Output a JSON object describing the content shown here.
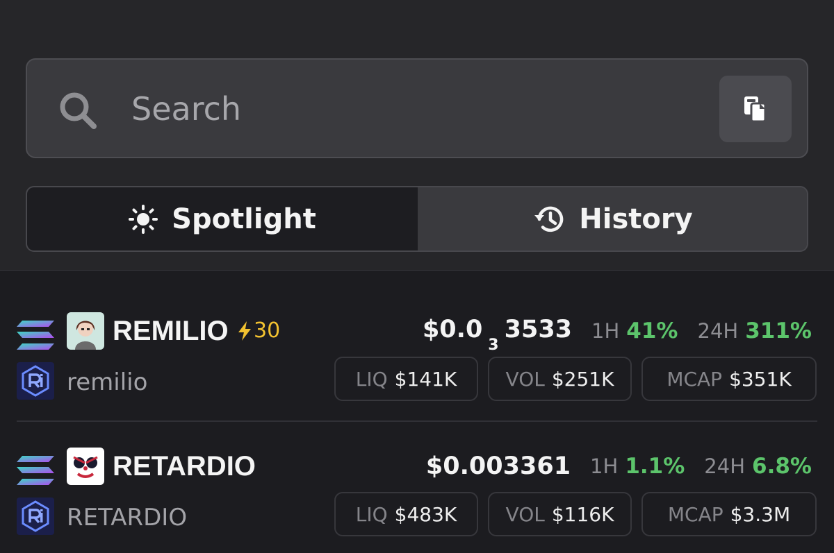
{
  "search": {
    "placeholder": "Search"
  },
  "tabs": [
    {
      "label": "Spotlight",
      "icon": "sun-icon",
      "active": true
    },
    {
      "label": "History",
      "icon": "history-icon",
      "active": false
    }
  ],
  "tokens": [
    {
      "chain_icon": "solana-icon",
      "dex_icon": "raydium-icon",
      "symbol": "REMILIO",
      "boost": "30",
      "name": "remilio",
      "price_prefix": "$0.0",
      "price_zeros": "3",
      "price_digits": "3533",
      "h1_label": "1H",
      "h1_change": "41%",
      "h24_label": "24H",
      "h24_change": "311%",
      "liq_label": "LIQ",
      "liq": "$141K",
      "vol_label": "VOL",
      "vol": "$251K",
      "mcap_label": "MCAP",
      "mcap": "$351K"
    },
    {
      "chain_icon": "solana-icon",
      "dex_icon": "raydium-icon",
      "symbol": "RETARDIO",
      "name": "RETARDIO",
      "price": "$0.003361",
      "h1_label": "1H",
      "h1_change": "1.1%",
      "h24_label": "24H",
      "h24_change": "6.8%",
      "liq_label": "LIQ",
      "liq": "$483K",
      "vol_label": "VOL",
      "vol": "$116K",
      "mcap_label": "MCAP",
      "mcap": "$3.3M"
    }
  ],
  "colors": {
    "positive": "#5cc46b",
    "boost": "#f2c230",
    "background": "#1c1c20"
  }
}
